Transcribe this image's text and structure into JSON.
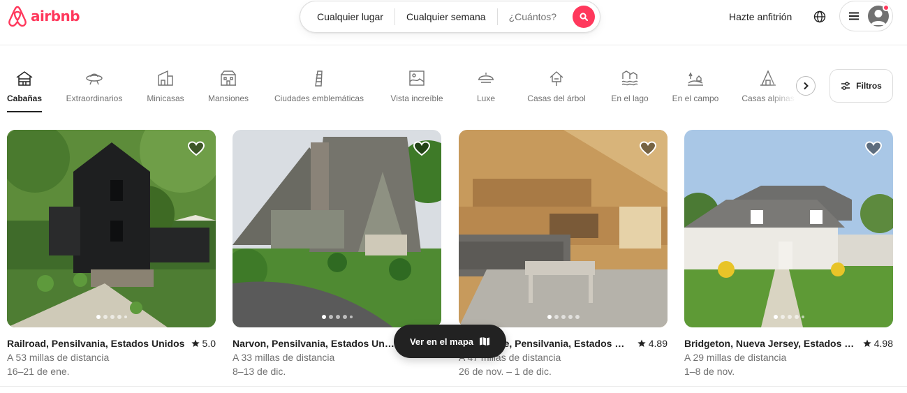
{
  "brand": {
    "name": "airbnb",
    "accent": "#ff385c"
  },
  "search": {
    "place": "Cualquier lugar",
    "week": "Cualquier semana",
    "guests": "¿Cuántos?",
    "button_icon": "search-icon"
  },
  "header": {
    "host_label": "Hazte anfitrión",
    "globe_icon": "globe-icon",
    "menu_icon": "hamburger-icon",
    "avatar_icon": "user-icon"
  },
  "categories": [
    {
      "label": "Cabañas",
      "icon": "cabin-icon",
      "active": true
    },
    {
      "label": "Extraordinarios",
      "icon": "ufo-icon"
    },
    {
      "label": "Minicasas",
      "icon": "tiny-house-icon"
    },
    {
      "label": "Mansiones",
      "icon": "mansion-icon"
    },
    {
      "label": "Ciudades emblemáticas",
      "icon": "leaning-tower-icon"
    },
    {
      "label": "Vista increíble",
      "icon": "picture-view-icon"
    },
    {
      "label": "Luxe",
      "icon": "luxe-icon"
    },
    {
      "label": "Casas del árbol",
      "icon": "treehouse-icon"
    },
    {
      "label": "En el lago",
      "icon": "lake-icon"
    },
    {
      "label": "En el campo",
      "icon": "countryside-icon"
    },
    {
      "label": "Casas alpinas",
      "icon": "a-frame-icon"
    }
  ],
  "filters_label": "Filtros",
  "listings": [
    {
      "title": "Railroad, Pensilvania, Estados Unidos",
      "rating": "5.0",
      "distance": "A 53 millas de distancia",
      "dates": "16–21 de ene."
    },
    {
      "title": "Narvon, Pensilvania, Estados Unidos",
      "rating": "",
      "distance": "A 33 millas de distancia",
      "dates": "8–13 de dic."
    },
    {
      "title": "Landisville, Pensilvania, Estados Unidos",
      "rating": "4.89",
      "distance": "A 47 millas de distancia",
      "dates": "26 de nov. – 1 de dic."
    },
    {
      "title": "Bridgeton, Nueva Jersey, Estados Unidos",
      "rating": "4.98",
      "distance": "A 29 millas de distancia",
      "dates": "1–8 de nov."
    }
  ],
  "map_button": {
    "label": "Ver en el mapa",
    "icon": "map-icon"
  }
}
